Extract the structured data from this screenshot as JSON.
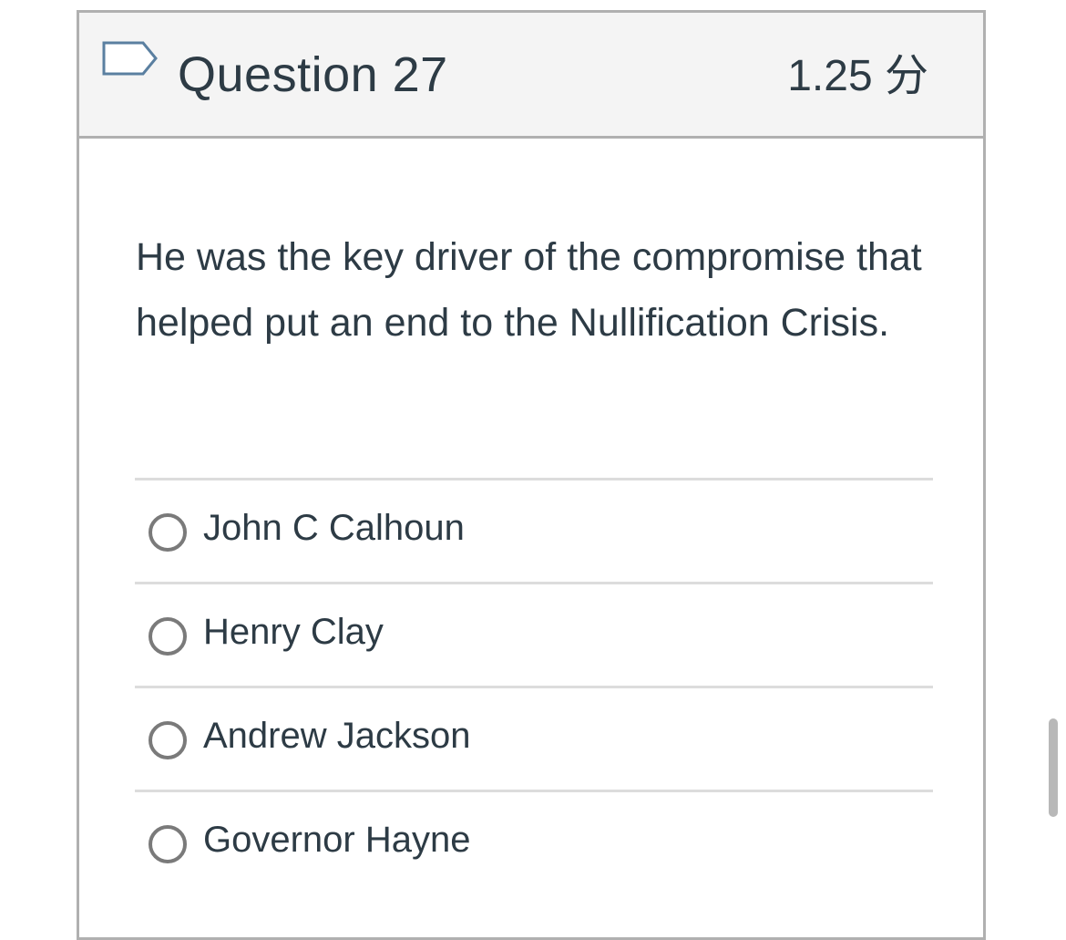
{
  "question": {
    "title": "Question 27",
    "points": "1.25 分",
    "text": "He was the key driver of the compromise that helped put an end to the Nullification Crisis."
  },
  "answers": [
    {
      "label": "John C Calhoun",
      "selected": false
    },
    {
      "label": "Henry Clay",
      "selected": false
    },
    {
      "label": "Andrew Jackson",
      "selected": false
    },
    {
      "label": "Governor Hayne",
      "selected": false
    }
  ],
  "icons": {
    "flag": "flag-question-icon"
  },
  "colors": {
    "text": "#2d3b45",
    "header_bg": "#f4f4f4",
    "flag_stroke": "#5a7fa0"
  }
}
